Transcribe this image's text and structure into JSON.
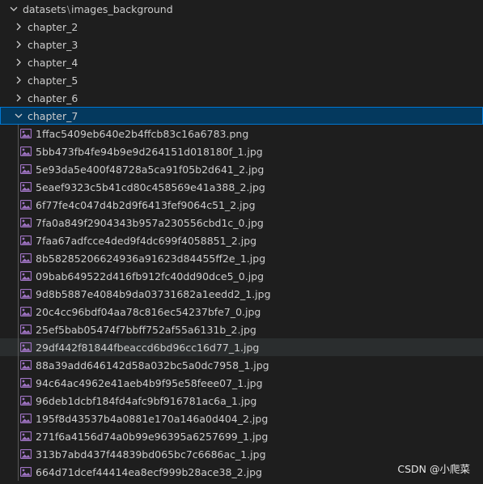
{
  "breadcrumb": {
    "root": "datasets",
    "separator": "\\",
    "leaf": "images_background"
  },
  "folders_collapsed": [
    {
      "label": "chapter_2"
    },
    {
      "label": "chapter_3"
    },
    {
      "label": "chapter_4"
    },
    {
      "label": "chapter_5"
    },
    {
      "label": "chapter_6"
    }
  ],
  "folder_expanded": {
    "label": "chapter_7"
  },
  "files": [
    {
      "name": "1ffac5409eb640e2b4ffcb83c16a6783.png"
    },
    {
      "name": "5bb473fb4fe94b9e9d264151d018180f_1.jpg"
    },
    {
      "name": "5e93da5e400f48728a5ca91f05b2d641_2.jpg"
    },
    {
      "name": "5eaef9323c5b41cd80c458569e41a388_2.jpg"
    },
    {
      "name": "6f77fe4c047d4b2d9f6413fef9064c51_2.jpg"
    },
    {
      "name": "7fa0a849f2904343b957a230556cbd1c_0.jpg"
    },
    {
      "name": "7faa67adfcce4ded9f4dc699f4058851_2.jpg"
    },
    {
      "name": "8b58285206624936a91623d84455ff2e_1.jpg"
    },
    {
      "name": "09bab649522d416fb912fc40dd90dce5_0.jpg"
    },
    {
      "name": "9d8b5887e4084b9da03731682a1eedd2_1.jpg"
    },
    {
      "name": "20c4cc96bdf04aa78c816ec54237bfe7_0.jpg"
    },
    {
      "name": "25ef5bab05474f7bbff752af55a6131b_2.jpg"
    },
    {
      "name": "29df442f81844fbeaccd6bd96cc16d77_1.jpg"
    },
    {
      "name": "88a39add646142d58a032bc5a0dc7958_1.jpg"
    },
    {
      "name": "94c64ac4962e41aeb4b9f95e58feee07_1.jpg"
    },
    {
      "name": "96deb1dcbf184fd4afc9bf916781ac6a_1.jpg"
    },
    {
      "name": "195f8d43537b4a0881e170a146a0d404_2.jpg"
    },
    {
      "name": "271f6a4156d74a0b99e96395a6257699_1.jpg"
    },
    {
      "name": "313b7abd437f44839bd065bc7c6686ac_1.jpg"
    },
    {
      "name": "664d71dcef44414ea8ecf999b28ace38_2.jpg"
    }
  ],
  "hovered_file_index": 12,
  "watermark": "CSDN @小爬菜",
  "colors": {
    "background": "#1e1e1e",
    "text": "#cccccc",
    "selection_bg": "#04395e",
    "selection_border": "#0078d4",
    "hover_bg": "#2a2d2e",
    "image_icon": "#a074c4"
  },
  "icons": {
    "breadcrumb_chevron": "chevron-down-icon",
    "collapsed_chevron": "chevron-right-icon",
    "expanded_chevron": "chevron-down-icon",
    "file_icon": "image-file-icon"
  }
}
